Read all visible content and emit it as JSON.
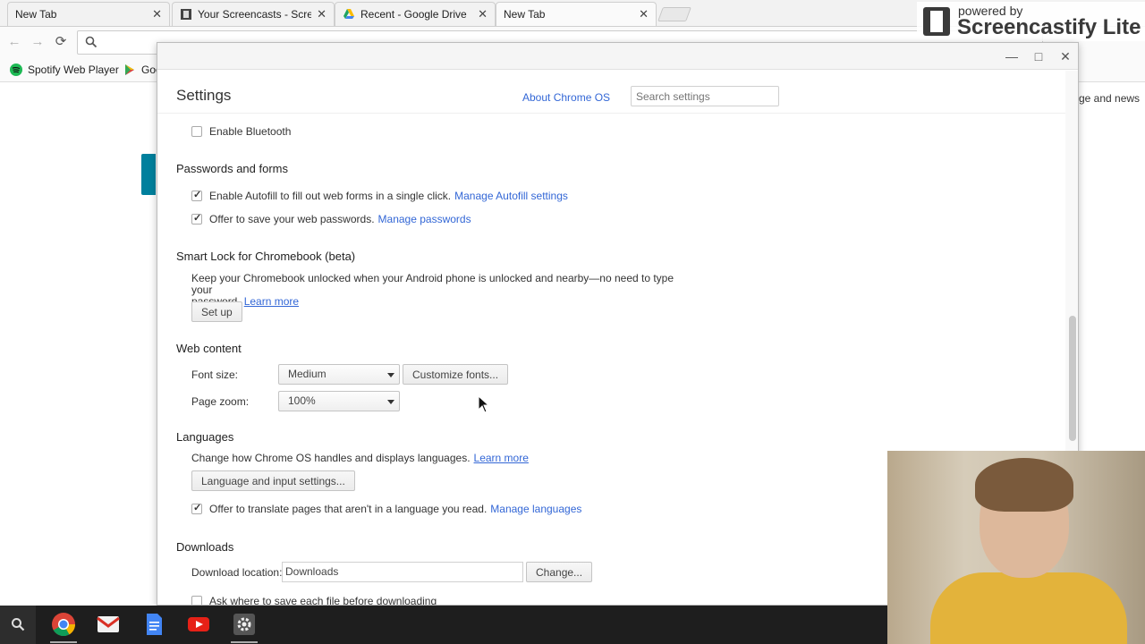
{
  "browser": {
    "tabs": [
      {
        "title": "New Tab",
        "active": false
      },
      {
        "title": "Your Screencasts - Scree",
        "active": false
      },
      {
        "title": "Recent - Google Drive",
        "active": false
      },
      {
        "title": "New Tab",
        "active": true
      }
    ],
    "omnibox_value": "",
    "bookmarks": [
      {
        "label": "Spotify Web Player"
      },
      {
        "label": "Goo"
      }
    ],
    "background_text": "ge and news"
  },
  "watermark": {
    "powered": "powered by",
    "brand": "Screencastify Lite"
  },
  "window": {
    "controls": {
      "minimize": "—",
      "maximize": "□",
      "close": "✕"
    }
  },
  "settings": {
    "title": "Settings",
    "about_link": "About Chrome OS",
    "search_placeholder": "Search settings",
    "bluetooth": {
      "label": "Enable Bluetooth",
      "checked": false
    },
    "passwords": {
      "title": "Passwords and forms",
      "autofill_label": "Enable Autofill to fill out web forms in a single click.",
      "autofill_link": "Manage Autofill settings",
      "save_label": "Offer to save your web passwords.",
      "save_link": "Manage passwords"
    },
    "smartlock": {
      "title": "Smart Lock for Chromebook (beta)",
      "desc_line1": "Keep your Chromebook unlocked when your Android phone is unlocked and nearby—no need to type your",
      "desc_line2": "password.",
      "learn_more": "Learn more",
      "setup_button": "Set up"
    },
    "web_content": {
      "title": "Web content",
      "font_size_label": "Font size:",
      "font_size_value": "Medium",
      "customize_button": "Customize fonts...",
      "page_zoom_label": "Page zoom:",
      "page_zoom_value": "100%"
    },
    "languages": {
      "title": "Languages",
      "desc": "Change how Chrome OS handles and displays languages.",
      "learn_more": "Learn more",
      "input_button": "Language and input settings...",
      "translate_label": "Offer to translate pages that aren't in a language you read.",
      "translate_link": "Manage languages"
    },
    "downloads": {
      "title": "Downloads",
      "location_label": "Download location:",
      "location_value": "Downloads",
      "change_button": "Change...",
      "ask_label": "Ask where to save each file before downloading"
    }
  },
  "shelf": {
    "apps": [
      "search-launcher",
      "chrome",
      "gmail",
      "docs",
      "youtube",
      "settings"
    ]
  },
  "colors": {
    "link": "#3367d6",
    "shelf": "#1e1e1e"
  }
}
